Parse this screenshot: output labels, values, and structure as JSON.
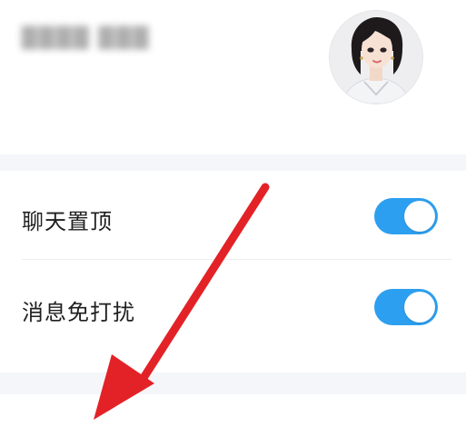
{
  "profile": {
    "name_blurred": "████ ███",
    "avatar_icon": "profile-avatar"
  },
  "settings": {
    "items": [
      {
        "label": "聊天置顶",
        "toggle_state": "on",
        "toggle_color": "#2d9ff0"
      },
      {
        "label": "消息免打扰",
        "toggle_state": "on",
        "toggle_color": "#2d9ff0"
      }
    ]
  },
  "annotation": {
    "arrow_color": "#e32227",
    "arrow_direction": "down-left"
  },
  "colors": {
    "background": "#ffffff",
    "section_band": "#f4f6fa",
    "text_primary": "#1f1f1f",
    "toggle_on": "#2d9ff0"
  }
}
